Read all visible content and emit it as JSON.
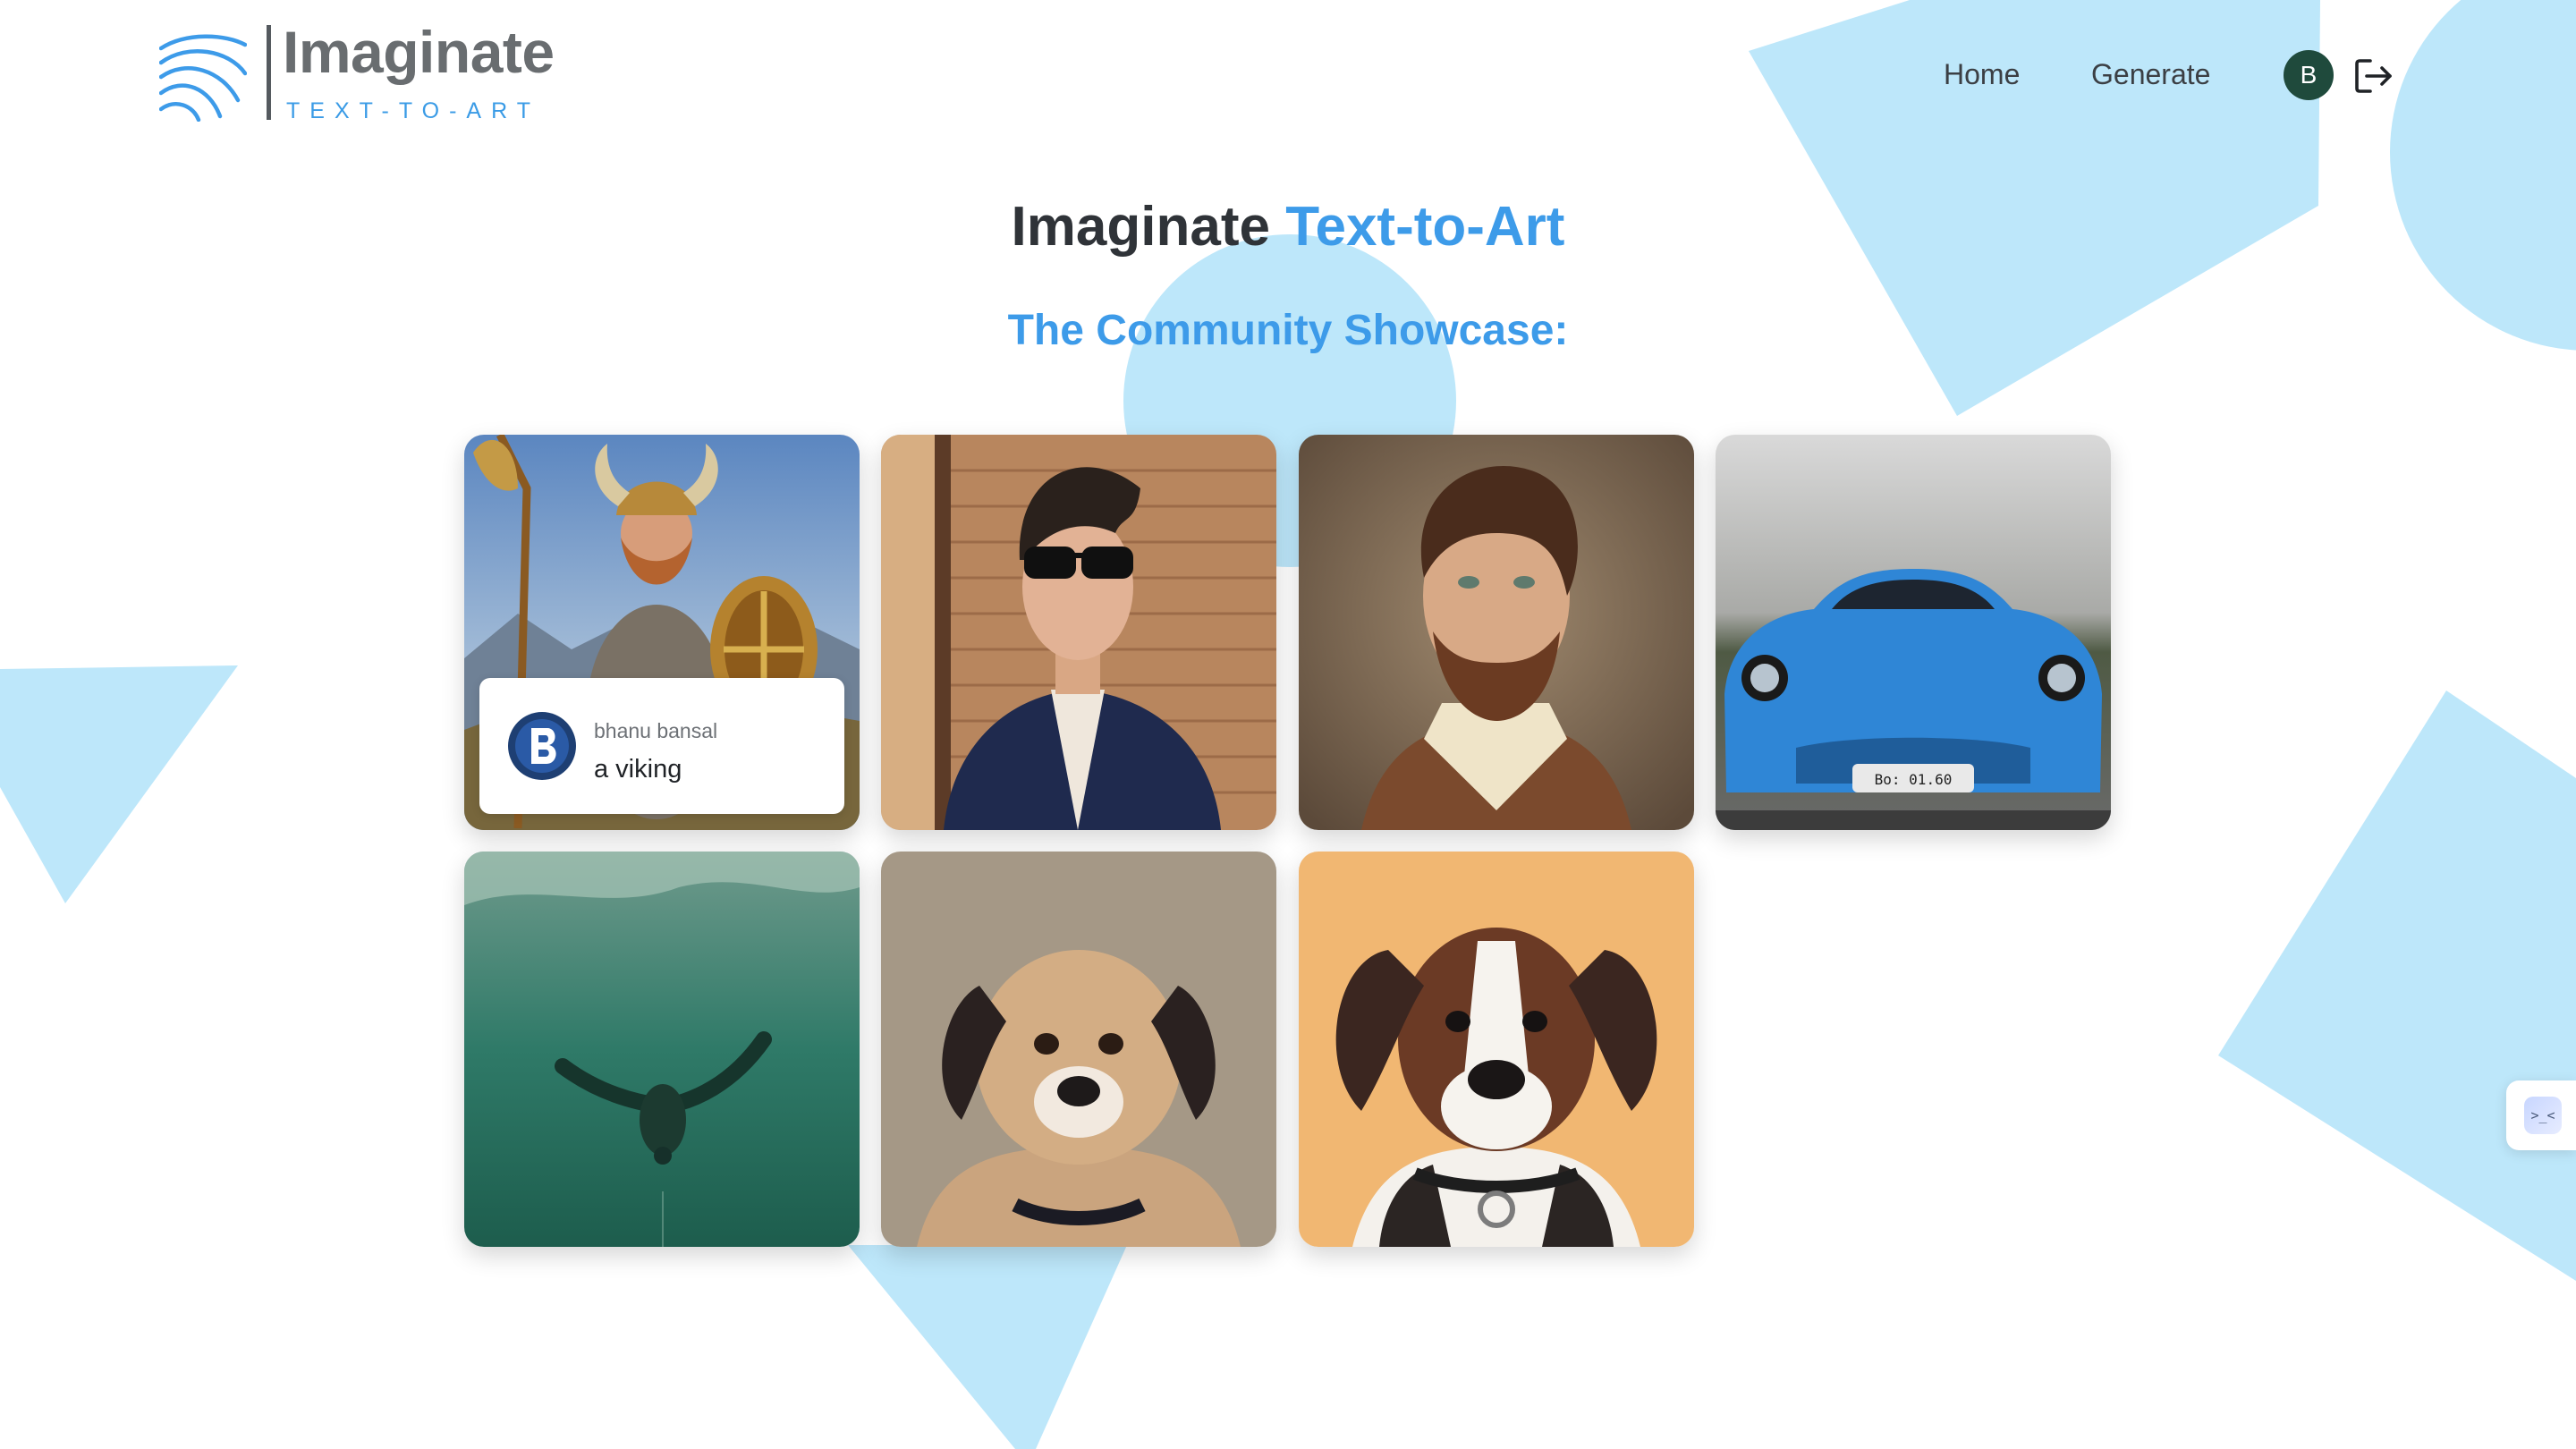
{
  "header": {
    "logo_name": "Imaginate",
    "logo_tagline": "TEXT-TO-ART",
    "nav": {
      "home": "Home",
      "generate": "Generate"
    },
    "user_initial": "B"
  },
  "main": {
    "title_prefix": "Imaginate",
    "title_accent": "Text-to-Art",
    "showcase_heading": "The Community Showcase:"
  },
  "gallery": [
    {
      "subject": "viking",
      "author": "bhanu bansal",
      "prompt": "a viking"
    },
    {
      "subject": "man-with-sunglasses"
    },
    {
      "subject": "bearded-man-portrait"
    },
    {
      "subject": "blue-sports-car",
      "plate": "Bo: 01.60"
    },
    {
      "subject": "underwater-swimmer"
    },
    {
      "subject": "puppy"
    },
    {
      "subject": "dog-painting"
    }
  ],
  "side_widget": {
    "glyph": ">_<"
  },
  "colors": {
    "accent": "#3d9be9",
    "shape": "#bde7fa",
    "avatar": "#1f4a3c"
  }
}
